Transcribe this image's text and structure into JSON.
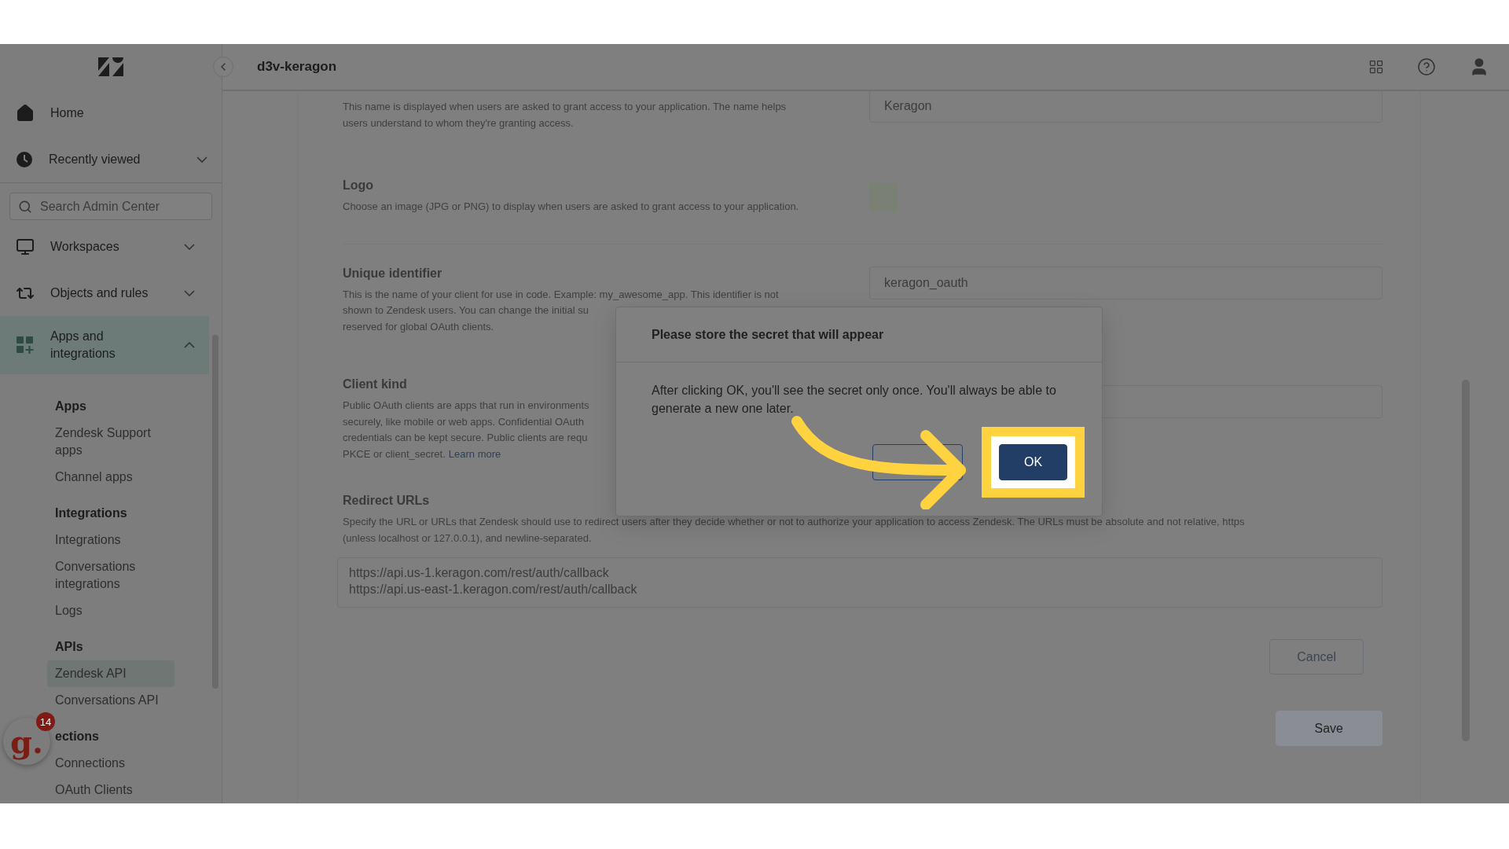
{
  "header": {
    "title": "d3v-keragon"
  },
  "sidebar": {
    "nav_top": [
      {
        "label": "Home",
        "selected": false
      },
      {
        "label": "Recently viewed",
        "selected": false,
        "expanded": false
      }
    ],
    "search": {
      "placeholder": "Search Admin Center"
    },
    "nav": [
      {
        "label": "Workspaces",
        "selected": false,
        "expanded": false
      },
      {
        "label": "Objects and rules",
        "selected": false,
        "expanded": false
      },
      {
        "label": "Apps and integrations",
        "selected": true,
        "expanded": true
      }
    ],
    "groups": [
      {
        "heading": "Apps",
        "items": [
          {
            "label": "Zendesk Support apps",
            "selected": false
          },
          {
            "label": "Channel apps",
            "selected": false
          }
        ]
      },
      {
        "heading": "Integrations",
        "items": [
          {
            "label": "Integrations",
            "selected": false
          },
          {
            "label": "Conversations integrations",
            "selected": false
          },
          {
            "label": "Logs",
            "selected": false
          }
        ]
      },
      {
        "heading": "APIs",
        "items": [
          {
            "label": "Zendesk API",
            "selected": true
          },
          {
            "label": "Conversations API",
            "selected": false
          }
        ]
      },
      {
        "heading": "ections",
        "items": [
          {
            "label": "Connections",
            "selected": false
          },
          {
            "label": "OAuth Clients",
            "selected": false
          }
        ]
      }
    ]
  },
  "form": {
    "sections": [
      {
        "kind": "text",
        "description": [
          "This name is displayed when users are asked to grant access to your application. The name helps",
          "users understand to whom they're granting access."
        ],
        "value": "Keragon"
      },
      {
        "kind": "logo",
        "title": "Logo",
        "description": [
          "Choose an image (JPG or PNG) to display when users are asked to grant access to your application."
        ]
      },
      {
        "kind": "text",
        "title": "Unique identifier",
        "description": [
          "This is the name of your client for use in code. Example: my_awesome_app. This identifier is not",
          "shown to Zendesk users. You can change the initial su",
          "reserved for global OAuth clients."
        ],
        "value": "keragon_oauth"
      },
      {
        "kind": "select",
        "title": "Client kind",
        "description": [
          "Public OAuth clients are apps that run in environments",
          "securely, like mobile or web apps. Confidential OAuth",
          "credentials can be kept secure. Public clients are requ",
          "PKCE or client_secret."
        ],
        "link": "Learn more"
      },
      {
        "kind": "textarea",
        "title": "Redirect URLs",
        "description": [
          "Specify the URL or URLs that Zendesk should use to redirect users after they decide whether or not to authorize your application to access Zendesk. The URLs must be absolute and not relative, https",
          "(unless localhost or 127.0.0.1), and newline-separated."
        ],
        "value": "https://api.us-1.keragon.com/rest/auth/callback\nhttps://api.us-east-1.keragon.com/rest/auth/callback"
      }
    ],
    "actions": [
      {
        "label": "Cancel",
        "kind": "secondary"
      },
      {
        "label": "Save",
        "kind": "primary"
      }
    ]
  },
  "dialog": {
    "title": "Please store the secret that will appear",
    "body": "After clicking OK, you'll see the secret only once. You'll always be able to generate a new one later.",
    "buttons": [
      {
        "kind": "secondary",
        "highlighted": false
      },
      {
        "label": "OK",
        "kind": "primary",
        "highlighted": true
      }
    ]
  },
  "chat_widget": {
    "logo": "g.",
    "badge": "14"
  }
}
